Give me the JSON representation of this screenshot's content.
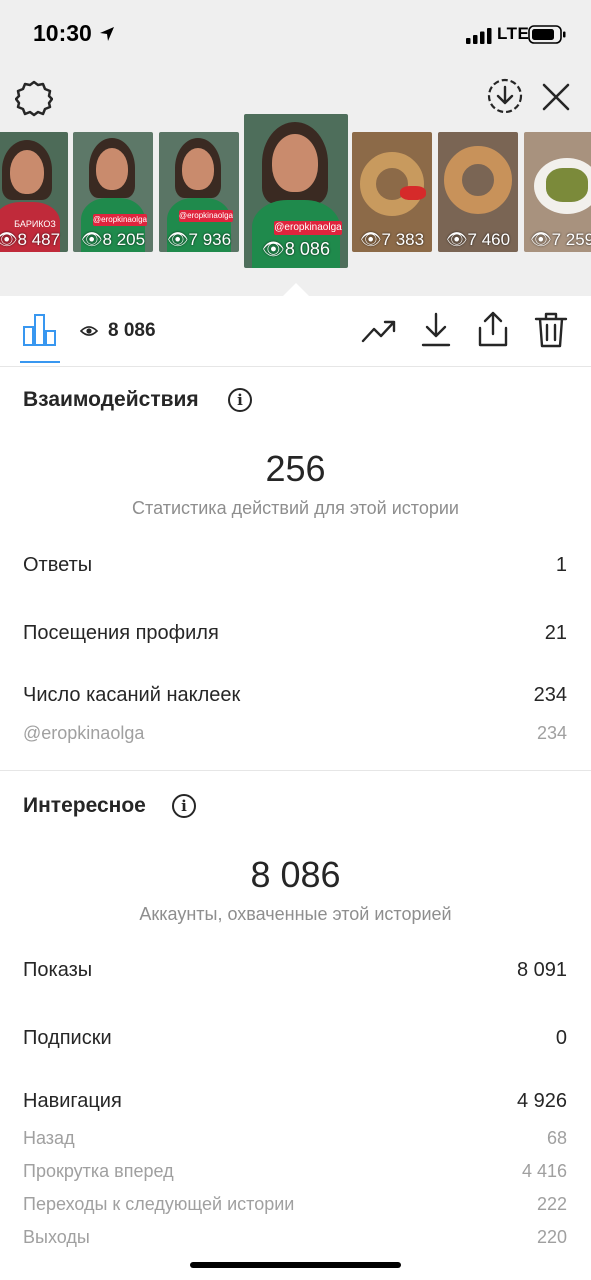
{
  "status_bar": {
    "time": "10:30",
    "network": "LTE"
  },
  "thumbnails": [
    {
      "views": "8 487",
      "tag": "БАРИКОЗ"
    },
    {
      "views": "8 205",
      "tag": "@eropkinaolga"
    },
    {
      "views": "7 936",
      "tag": "@eropkinaolga"
    },
    {
      "views": "8 086",
      "tag": "@eropkinaolga"
    },
    {
      "views": "7 383"
    },
    {
      "views": "7 460"
    },
    {
      "views": "7 259"
    }
  ],
  "tabbar": {
    "views": "8 086"
  },
  "interactions": {
    "title": "Взаимодействия",
    "total": "256",
    "subtitle": "Статистика действий для этой истории",
    "rows": [
      {
        "label": "Ответы",
        "value": "1"
      },
      {
        "label": "Посещения профиля",
        "value": "21"
      },
      {
        "label": "Число касаний наклеек",
        "value": "234"
      }
    ],
    "sticker_sub": {
      "label": "@eropkinaolga",
      "value": "234"
    }
  },
  "discovery": {
    "title": "Интересное",
    "total": "8 086",
    "subtitle": "Аккаунты, охваченные этой историей",
    "rows": [
      {
        "label": "Показы",
        "value": "8 091"
      },
      {
        "label": "Подписки",
        "value": "0"
      },
      {
        "label": "Навигация",
        "value": "4 926"
      }
    ],
    "navigation_sub": [
      {
        "label": "Назад",
        "value": "68"
      },
      {
        "label": "Прокрутка вперед",
        "value": "4 416"
      },
      {
        "label": "Переходы к следующей истории",
        "value": "222"
      },
      {
        "label": "Выходы",
        "value": "220"
      }
    ]
  },
  "colors": {
    "accent": "#3897f0",
    "tag_red": "#e0243d",
    "background_top": "#efefef"
  },
  "icons": [
    "settings-gear-icon",
    "download-circle-icon",
    "close-icon",
    "bar-chart-icon",
    "eye-icon",
    "trending-icon",
    "download-icon",
    "share-icon",
    "trash-icon",
    "info-icon"
  ]
}
